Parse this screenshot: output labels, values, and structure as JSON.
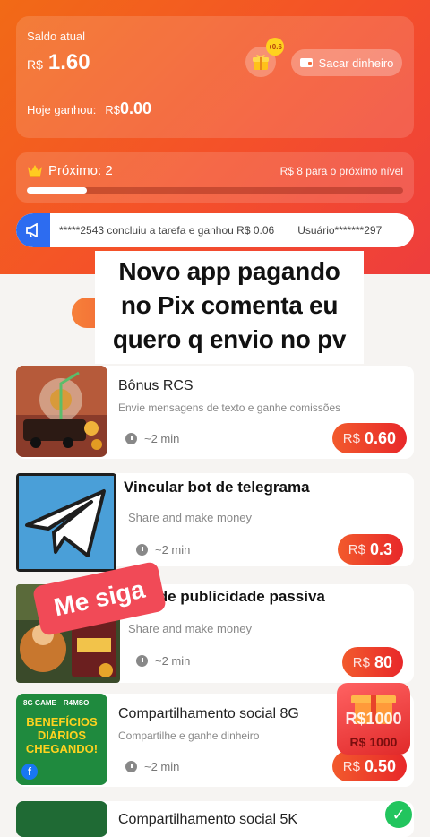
{
  "balance": {
    "label": "Saldo atual",
    "currency": "R$",
    "amount": "1.60",
    "today_label": "Hoje ganhou:",
    "today_currency": "R$",
    "today_amount": "0.00",
    "gift_badge": "+0.6",
    "withdraw_label": "Sacar dinheiro"
  },
  "level": {
    "title": "Próximo: 2",
    "next_text": "R$ 8 para o próximo nível",
    "progress": 0.16
  },
  "ticker": {
    "message_1": "*****2543 concluiu a tarefa e ganhou R$ 0.06",
    "message_2": "Usuário*******297"
  },
  "overlay": {
    "text": "Novo app pagando no Pix comenta eu quero q envio no pv",
    "sticker": "Me siga"
  },
  "tasks": [
    {
      "title": "Bônus RCS",
      "desc": "Envie mensagens de texto e ganhe comissões",
      "time": "~2 min",
      "currency": "R$",
      "reward": "0.60"
    },
    {
      "title": "Vincular bot de telegrama",
      "desc": "Share and make money",
      "time": "~2 min",
      "currency": "R$",
      "reward": "0.3"
    },
    {
      "title": "...ita de publicidade passiva",
      "desc": "Share and make money",
      "time": "~2 min",
      "currency": "R$",
      "reward": "80"
    },
    {
      "title": "Compartilhamento social 8G",
      "desc": "Compartilhe e ganhe dinheiro",
      "time": "~2 min",
      "currency": "R$",
      "reward": "0.50"
    },
    {
      "title": "Compartilhamento social 5K"
    }
  ],
  "thumb_texts": {
    "benef_line1": "BENEFÍCIOS",
    "benef_line2": "DIÁRIOS",
    "benef_line3": "CHEGANDO!",
    "brand_8g": "8G GAME",
    "brand_r4": "R4MSO"
  },
  "floating_gift": {
    "amount": "R$1000",
    "amount2": "R$ 1000"
  },
  "colors": {
    "header_start": "#f26a16",
    "header_end": "#ee3d3d",
    "accent": "#e8282a",
    "telegram": "#4a9fd8"
  }
}
